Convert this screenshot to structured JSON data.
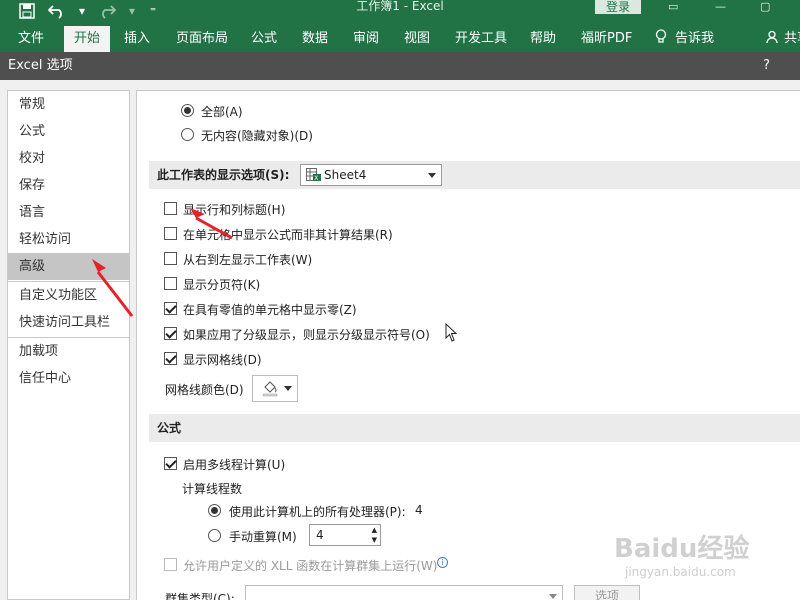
{
  "excel": {
    "window_title": "工作簿1  -  Excel",
    "login_label": "登录",
    "ribbon_tabs": [
      {
        "label": "文件"
      },
      {
        "label": "开始"
      },
      {
        "label": "插入"
      },
      {
        "label": "页面布局"
      },
      {
        "label": "公式"
      },
      {
        "label": "数据"
      },
      {
        "label": "审阅"
      },
      {
        "label": "视图"
      },
      {
        "label": "开发工具"
      },
      {
        "label": "帮助"
      },
      {
        "label": "福昕PDF"
      },
      {
        "label": "告诉我"
      },
      {
        "label": "共享"
      }
    ],
    "active_tab": "开始"
  },
  "dialog": {
    "title": "Excel 选项",
    "help": "?",
    "nav_items": [
      {
        "label": "常规"
      },
      {
        "label": "公式"
      },
      {
        "label": "校对"
      },
      {
        "label": "保存"
      },
      {
        "label": "语言"
      },
      {
        "label": "轻松访问"
      },
      {
        "label": "高级"
      },
      {
        "label": "自定义功能区"
      },
      {
        "label": "快速访问工具栏"
      },
      {
        "label": "加载项"
      },
      {
        "label": "信任中心"
      }
    ],
    "selected_nav": "高级"
  },
  "objects": {
    "all": {
      "label": "全部(A)",
      "checked": true
    },
    "none": {
      "label": "无内容(隐藏对象)(D)",
      "checked": false
    }
  },
  "sheet_options": {
    "section_label": "此工作表的显示选项(S):",
    "sheet_select": "Sheet4",
    "items": [
      {
        "label": "显示行和列标题(H)",
        "checked": false
      },
      {
        "label": "在单元格中显示公式而非其计算结果(R)",
        "checked": false
      },
      {
        "label": "从右到左显示工作表(W)",
        "checked": false
      },
      {
        "label": "显示分页符(K)",
        "checked": false
      },
      {
        "label": "在具有零值的单元格中显示零(Z)",
        "checked": true
      },
      {
        "label": "如果应用了分级显示，则显示分级显示符号(O)",
        "checked": true
      },
      {
        "label": "显示网格线(D)",
        "checked": true
      }
    ],
    "gridline_color_label": "网格线颜色(D)"
  },
  "formulas": {
    "section_title": "公式",
    "multithread": {
      "label": "启用多线程计算(U)",
      "checked": true
    },
    "thread_count_label": "计算线程数",
    "use_all": {
      "label": "使用此计算机上的所有处理器(P):",
      "value": "4",
      "checked": true
    },
    "manual": {
      "label": "手动重算(M)",
      "value": "4",
      "checked": false
    },
    "xll": {
      "label": "允许用户定义的 XLL 函数在计算群集上运行(W)",
      "checked": false,
      "disabled": true
    },
    "cluster_type_label": "群集类型(C):",
    "options_button": "选项"
  },
  "watermark": {
    "text": "Baidu经验",
    "sub": "jingyan.baidu.com"
  },
  "colors": {
    "excel_green": "#217346",
    "dialog_title": "#4f4f4f",
    "arrow_red": "#e8202a"
  }
}
